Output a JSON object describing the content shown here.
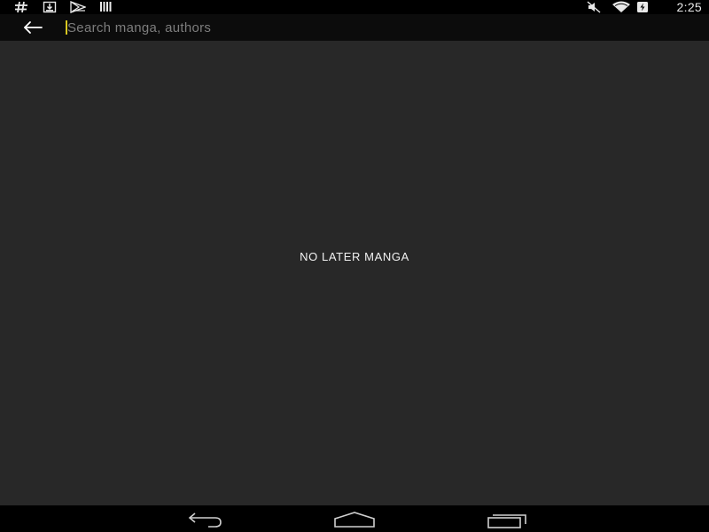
{
  "status_bar": {
    "left_icons": [
      "hashtag-icon",
      "download-icon",
      "play-store-icon",
      "barcode-icon"
    ],
    "right_icons": [
      "mute-icon",
      "wifi-icon",
      "battery-icon"
    ],
    "time": "2:25"
  },
  "search": {
    "placeholder": "Search manga, authors",
    "value": ""
  },
  "content": {
    "empty_message": "NO LATER MANGA"
  },
  "nav_bar": {
    "buttons": [
      "back-nav-icon",
      "home-nav-icon",
      "recents-nav-icon"
    ]
  },
  "colors": {
    "background": "#282828",
    "toolbar": "#0c0c0c",
    "status_bar": "#000000",
    "caret": "#d9c820",
    "placeholder": "#7d7d7d"
  }
}
